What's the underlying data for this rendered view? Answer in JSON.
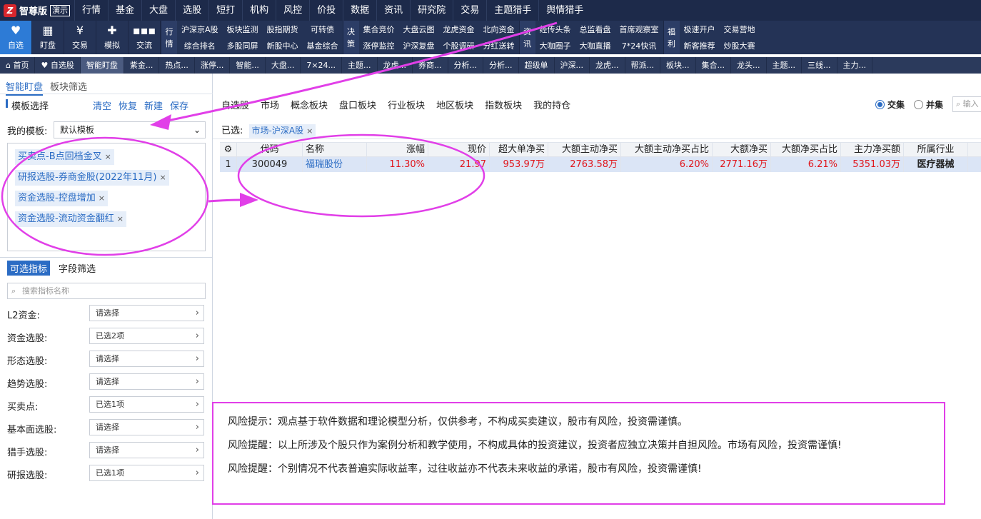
{
  "app": {
    "logo_badge": "Z",
    "name": "智尊版",
    "demo": "演示"
  },
  "topmenu": [
    "行情",
    "基金",
    "大盘",
    "选股",
    "短打",
    "机构",
    "风控",
    "价投",
    "数据",
    "资讯",
    "研究院",
    "交易",
    "主题猎手",
    "舆情猎手"
  ],
  "bigbtns": [
    {
      "label": "自选",
      "icon": "heart-icon",
      "glyph": "♥"
    },
    {
      "label": "盯盘",
      "icon": "chart-icon",
      "glyph": "▦"
    },
    {
      "label": "交易",
      "icon": "yen-icon",
      "glyph": "¥"
    },
    {
      "label": "模拟",
      "icon": "gamepad-icon",
      "glyph": "✚"
    },
    {
      "label": "交流",
      "icon": "chat-icon",
      "glyph": "▪▪▪"
    }
  ],
  "groups": [
    {
      "head": "行情",
      "items": [
        "沪深京A股",
        "综合排名",
        "板块监测",
        "多股同屏",
        "股指期货",
        "新股中心",
        "可转债",
        "基金综合"
      ]
    },
    {
      "head": "决策",
      "items": [
        "集合竞价",
        "涨停监控",
        "大盘云图",
        "沪深复盘",
        "龙虎资金",
        "个股调研",
        "北向资金",
        "分红送转"
      ]
    },
    {
      "head": "资讯",
      "items": [
        "经传头条",
        "大咖圈子",
        "总监看盘",
        "大咖直播",
        "首席观察室",
        "7*24快讯"
      ]
    },
    {
      "head": "福利",
      "items": [
        "极速开户",
        "新客推荐",
        "交易营地",
        "炒股大赛"
      ]
    }
  ],
  "tabs": [
    "首页",
    "自选股",
    "智能盯盘",
    "紫金...",
    "热点...",
    "涨停...",
    "智能...",
    "大盘...",
    "7×24...",
    "主题...",
    "龙虎...",
    "券商...",
    "分析...",
    "分析...",
    "超级单",
    "沪深...",
    "龙虎...",
    "帮派...",
    "板块...",
    "集合...",
    "龙头...",
    "主题...",
    "三线...",
    "主力..."
  ],
  "left": {
    "subtabs": [
      "智能盯盘",
      "板块筛选"
    ],
    "section_title": "模板选择",
    "actions": [
      "清空",
      "恢复",
      "新建",
      "保存"
    ],
    "my_template_label": "我的模板:",
    "my_template_value": "默认模板",
    "tags": [
      "买卖点-B点回档金叉",
      "研报选股-券商金股(2022年11月)",
      "资金选股-控盘增加",
      "资金选股-流动资金翻红"
    ],
    "tabs2": [
      "可选指标",
      "字段筛选"
    ],
    "search_placeholder": "搜索指标名称",
    "filters": [
      {
        "label": "L2资金:",
        "value": "请选择"
      },
      {
        "label": "资金选股:",
        "value": "已选2项"
      },
      {
        "label": "形态选股:",
        "value": "请选择"
      },
      {
        "label": "趋势选股:",
        "value": "请选择"
      },
      {
        "label": "买卖点:",
        "value": "已选1项"
      },
      {
        "label": "基本面选股:",
        "value": "请选择"
      },
      {
        "label": "猎手选股:",
        "value": "请选择"
      },
      {
        "label": "研报选股:",
        "value": "已选1项"
      }
    ]
  },
  "categories": [
    "自选股",
    "市场",
    "概念板块",
    "盘口板块",
    "行业板块",
    "地区板块",
    "指数板块",
    "我的持仓"
  ],
  "radios": [
    {
      "label": "交集",
      "on": true
    },
    {
      "label": "并集",
      "on": false
    }
  ],
  "search_right": "输入",
  "selected_label": "已选:",
  "selected_tag": "市场-沪深A股",
  "table": {
    "headers": [
      "",
      "代码",
      "名称",
      "涨幅",
      "现价",
      "超大单净买",
      "大额主动净买",
      "大额主动净买占比",
      "大额净买",
      "大额净买占比",
      "主力净买额",
      "所属行业"
    ],
    "rows": [
      [
        "1",
        "300049",
        "福瑞股份",
        "11.30%",
        "21.97",
        "953.97万",
        "2763.58万",
        "6.20%",
        "2771.16万",
        "6.21%",
        "5351.03万",
        "医疗器械"
      ]
    ]
  },
  "risk": [
    "风险提示：观点基于软件数据和理论模型分析，仅供参考，不构成买卖建议，股市有风险，投资需谨慎。",
    "风险提醒：以上所涉及个股只作为案例分析和教学使用，不构成具体的投资建议，投资者应独立决策并自担风险。市场有风险，投资需谨慎!",
    "风险提醒：个别情况不代表普遍实际收益率，过往收益亦不代表未来收益的承诺，股市有风险，投资需谨慎!"
  ],
  "colors": {
    "accent": "#2b6cc4",
    "annotation": "#e13fe8",
    "up": "#e0151b"
  }
}
